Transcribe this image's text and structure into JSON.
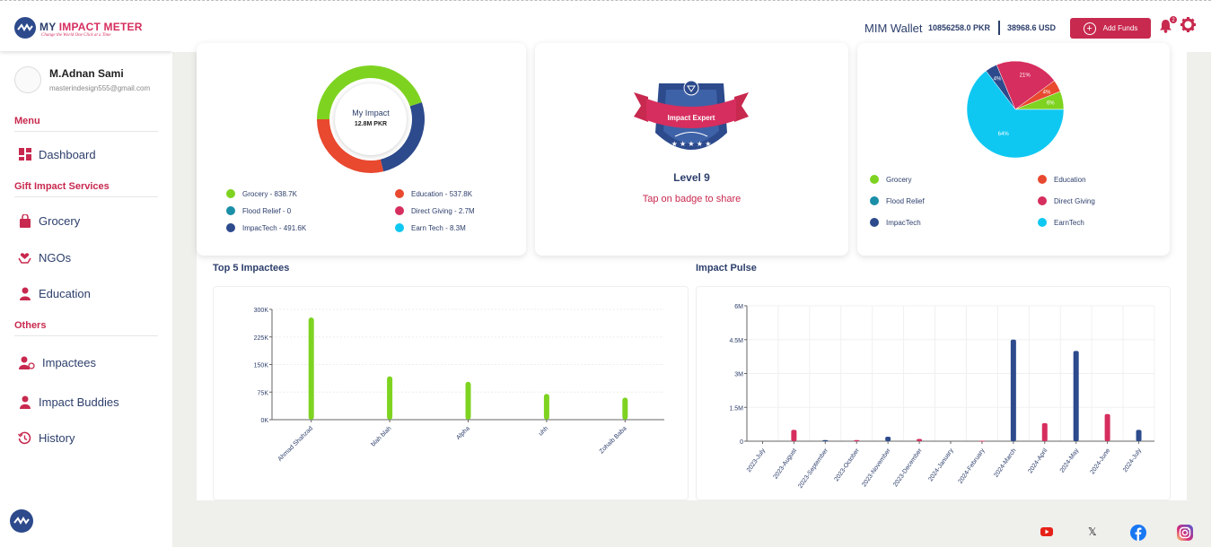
{
  "app": {
    "logo_title_a": "MY ",
    "logo_title_b": "IMPACT METER",
    "logo_tagline": "Change the World One Click at a Time"
  },
  "user": {
    "name": "M.Adnan Sami",
    "email": "masterindesign555@gmail.com"
  },
  "sidebar": {
    "menu_heading": "Menu",
    "gift_heading": "Gift Impact Services",
    "others_heading": "Others",
    "items": [
      {
        "label": "Dashboard",
        "icon": "dashboard-icon"
      },
      {
        "label": "Grocery",
        "icon": "shopping-bag-icon"
      },
      {
        "label": "NGOs",
        "icon": "hands-heart-icon"
      },
      {
        "label": "Education",
        "icon": "graduate-icon"
      },
      {
        "label": "Impactees",
        "icon": "people-icon"
      },
      {
        "label": "Impact Buddies",
        "icon": "person-icon"
      },
      {
        "label": "History",
        "icon": "history-icon"
      }
    ]
  },
  "header": {
    "wallet_label": "MIM Wallet",
    "wallet_pkr": "10856258.0 PKR",
    "wallet_usd": "38968.6 USD",
    "add_funds": "Add Funds",
    "notification_count": "2"
  },
  "impact_card": {
    "center_title": "My Impact",
    "center_value": "12.8M PKR",
    "legend": [
      {
        "label": "Grocery - 838.7K",
        "color": "#7ed321"
      },
      {
        "label": "Education - 537.8K",
        "color": "#e8492f"
      },
      {
        "label": "Flood Relief - 0",
        "color": "#1b8fa8"
      },
      {
        "label": "Direct Giving - 2.7M",
        "color": "#d62e5e"
      },
      {
        "label": "ImpacTech - 491.6K",
        "color": "#2c4a8c"
      },
      {
        "label": "Earn Tech - 8.3M",
        "color": "#0fc8f2"
      }
    ]
  },
  "badge_card": {
    "badge_text": "Impact Expert",
    "level": "Level 9",
    "share_text": "Tap on badge to share"
  },
  "pie_card": {
    "slice_labels": [
      "4%",
      "21%",
      "4%",
      "6%",
      "64%"
    ],
    "legend": [
      {
        "label": "Grocery",
        "color": "#7ed321"
      },
      {
        "label": "Education",
        "color": "#e8492f"
      },
      {
        "label": "Flood Relief",
        "color": "#1b8fa8"
      },
      {
        "label": "Direct Giving",
        "color": "#d62e5e"
      },
      {
        "label": "ImpacTech",
        "color": "#2c4a8c"
      },
      {
        "label": "EarnTech",
        "color": "#0fc8f2"
      }
    ]
  },
  "top5": {
    "title": "Top 5 Impactees"
  },
  "pulse": {
    "title": "Impact Pulse"
  },
  "chart_data": [
    {
      "type": "bar",
      "title": "Top 5 Impactees",
      "categories": [
        "Ahmad Shahzad",
        "blah blah",
        "Alpha",
        "uhh",
        "Zohaib Baba"
      ],
      "values": [
        278000,
        118000,
        103000,
        70000,
        60000
      ],
      "ylim": [
        0,
        300000
      ],
      "yticks": [
        "0K",
        "75K",
        "150K",
        "225K",
        "300K"
      ],
      "color": "#7ed321"
    },
    {
      "type": "bar",
      "title": "Impact Pulse",
      "categories": [
        "2023-July",
        "2023-August",
        "2023-September",
        "2023-October",
        "2023-November",
        "2023-December",
        "2024-January",
        "2024-February",
        "2024-March",
        "2024-April",
        "2024-May",
        "2024-June",
        "2024-July"
      ],
      "series": [
        {
          "color": "#2c4a8c",
          "values": [
            0,
            0,
            50000,
            0,
            200000,
            0,
            0,
            0,
            4500000,
            0,
            4000000,
            0,
            500000
          ]
        },
        {
          "color": "#d62e5e",
          "values": [
            0,
            500000,
            0,
            50000,
            0,
            100000,
            0,
            20000,
            0,
            800000,
            0,
            1200000,
            0
          ]
        }
      ],
      "ylim": [
        0,
        6000000
      ],
      "yticks": [
        "0",
        "1.5M",
        "3M",
        "4.5M",
        "6M"
      ]
    },
    {
      "type": "pie",
      "labels": [
        "Grocery",
        "Education",
        "Flood Relief",
        "Direct Giving",
        "ImpacTech",
        "EarnTech"
      ],
      "values": [
        6,
        4,
        0,
        21,
        4,
        64
      ]
    },
    {
      "type": "pie",
      "title": "My Impact",
      "labels": [
        "Grocery",
        "Education",
        "Flood Relief",
        "Direct Giving",
        "ImpacTech",
        "Earn Tech"
      ],
      "values": [
        838.7,
        537.8,
        0,
        2700,
        491.6,
        8300
      ]
    }
  ],
  "footer": {
    "icons": [
      "youtube-icon",
      "x-icon",
      "facebook-icon",
      "instagram-icon"
    ]
  }
}
